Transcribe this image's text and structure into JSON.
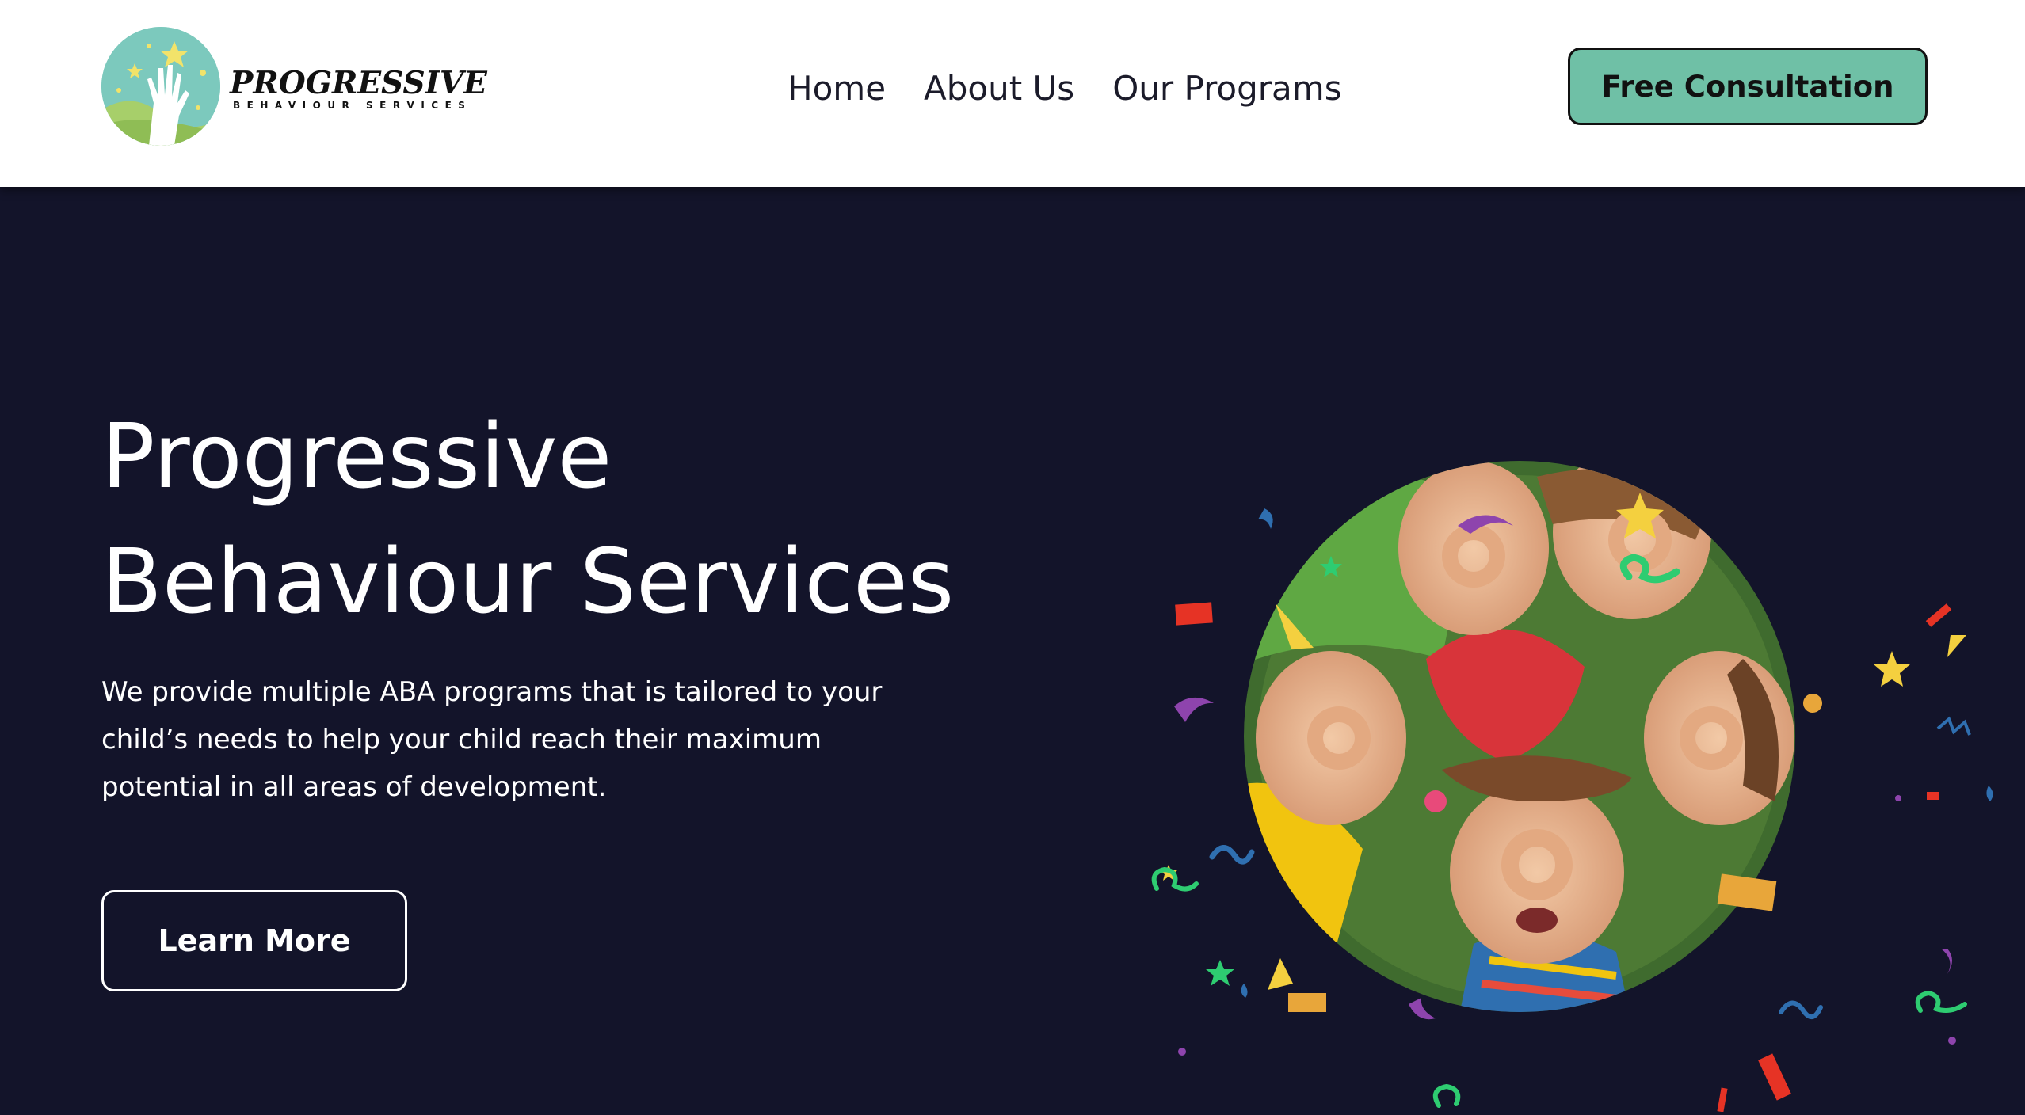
{
  "brand": {
    "name": "PROGRESSIVE",
    "tagline": "BEHAVIOUR SERVICES"
  },
  "nav": {
    "items": [
      {
        "label": "Home"
      },
      {
        "label": "About Us"
      },
      {
        "label": "Our Programs"
      }
    ],
    "cta_label": "Free Consultation"
  },
  "hero": {
    "title_line1": "Progressive",
    "title_line2": "Behaviour Services",
    "description": "We provide multiple ABA programs that is tailored to your child’s needs to help your child reach their maximum potential in all areas of development.",
    "button_label": "Learn More"
  },
  "colors": {
    "header_bg": "#ffffff",
    "hero_bg": "#13142a",
    "accent": "#6fc0a6",
    "text_light": "#ffffff",
    "text_dark": "#1b1b2a"
  },
  "icons": {
    "logo": "hand-reaching-stars-icon"
  }
}
